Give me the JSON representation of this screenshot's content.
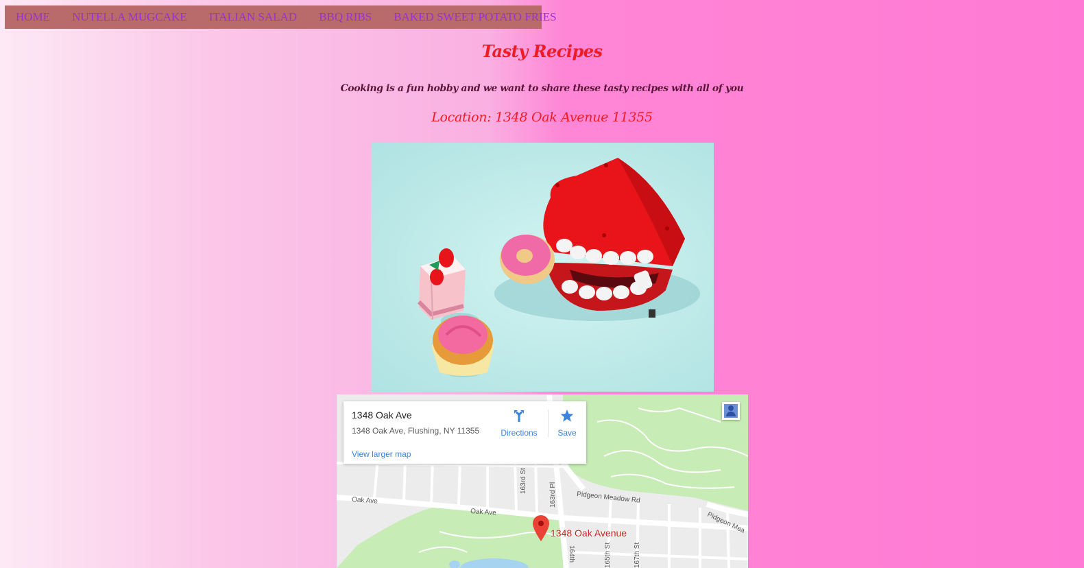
{
  "nav": {
    "items": [
      {
        "label": "HOME"
      },
      {
        "label": "NUTELLA MUGCAKE"
      },
      {
        "label": "ITALIAN SALAD"
      },
      {
        "label": "BBQ RIBS"
      },
      {
        "label": "BAKED SWEET POTATO FRIES"
      }
    ],
    "link_color": "#9b2fd3",
    "bar_color": "#b96a6a"
  },
  "header": {
    "title": "Tasty Recipes",
    "subtitle": "Cooking is a fun hobby and we want to share these tasty recipes with all of you",
    "location": "Location: 1348 Oak Avenue 11355",
    "title_color": "#ef1c25"
  },
  "map": {
    "place_name": "1348 Oak Ave",
    "address": "1348 Oak Ave, Flushing, NY 11355",
    "directions_label": "Directions",
    "save_label": "Save",
    "larger_map_label": "View larger map",
    "pin_label": "1348 Oak Avenue",
    "streets": {
      "oak_ave_left": "Oak Ave",
      "oak_ave_mid": "Oak Ave",
      "pidgeon_meadow": "Pidgeon Meadow Rd",
      "pidgeon_meadow_right": "Pidgeon Mea",
      "st_163": "163rd St",
      "pl_163": "163rd Pl",
      "st_164": "164th",
      "st_165": "165th St",
      "st_167": "167th St"
    }
  },
  "photo": {
    "icon": "wind-up-teeth-with-sweets-image"
  }
}
